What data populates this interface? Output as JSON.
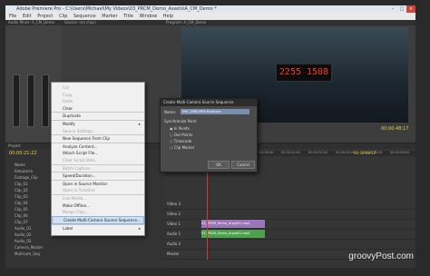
{
  "window": {
    "title": "Adobe Premiere Pro - C:\\Users\\Michael\\My Videos\\03_PRCM_Demo_Assets\\A_CM_Demo *",
    "controls": [
      "–",
      "□",
      "×"
    ]
  },
  "menubar": [
    "File",
    "Edit",
    "Project",
    "Clip",
    "Sequence",
    "Marker",
    "Title",
    "Window",
    "Help"
  ],
  "panels": {
    "audio_mixer_tab": "Audio Mixer: A_CM_Demo",
    "source_tab": "Source: (no clips)",
    "program_tab": "Program: A_CM_Demo",
    "project_tab": "Project",
    "timeline_tab": "Timeline: A_CM_Demo"
  },
  "video": {
    "clapper_text": "2255 1508"
  },
  "timecodes": {
    "program": "00:00:48:17",
    "left": "00:00:21:22",
    "timeline": "00:00:48:17"
  },
  "project_rows": [
    "Name",
    "Simulacra",
    "Footage_Clip",
    "Clip_01",
    "Clip_02",
    "Clip_03",
    "Clip_04",
    "Clip_05",
    "Clip_06",
    "Clip_07",
    "Audio_01",
    "Audio_02",
    "Audio_03",
    "Camera_Master",
    "Multicam_Seq"
  ],
  "timeline": {
    "ruler": [
      "00:00",
      "00:00:08:00",
      "00:00:16:00",
      "00:00:24:00",
      "00:00:32:00",
      "00:00:40:00",
      "00:00:48:00",
      "00:00:56:00"
    ],
    "tracks": [
      "Video 3",
      "Video 2",
      "Video 1",
      "Audio 1",
      "Audio 2",
      "Master"
    ],
    "clip_video_label": "03_PRCM_Demo_Angle01.mp4",
    "clip_audio_label": "03_PRCM_Demo_Angle01.mp4"
  },
  "context_menu": {
    "items": [
      {
        "label": "Cut",
        "enabled": false,
        "sep": false,
        "sub": false
      },
      {
        "label": "Copy",
        "enabled": false,
        "sep": false,
        "sub": false
      },
      {
        "label": "Paste",
        "enabled": false,
        "sep": false,
        "sub": false
      },
      {
        "label": "Clear",
        "enabled": true,
        "sep": false,
        "sub": false
      },
      {
        "label": "Duplicate",
        "enabled": true,
        "sep": true,
        "sub": false
      },
      {
        "label": "Modify",
        "enabled": true,
        "sep": true,
        "sub": true
      },
      {
        "label": "Source Settings...",
        "enabled": false,
        "sep": false,
        "sub": false
      },
      {
        "label": "New Sequence From Clip",
        "enabled": true,
        "sep": true,
        "sub": false
      },
      {
        "label": "Analyze Content...",
        "enabled": true,
        "sep": true,
        "sub": false
      },
      {
        "label": "Attach Script File...",
        "enabled": true,
        "sep": false,
        "sub": false
      },
      {
        "label": "Clear Script Data",
        "enabled": false,
        "sep": false,
        "sub": false
      },
      {
        "label": "Batch Capture...",
        "enabled": false,
        "sep": true,
        "sub": false
      },
      {
        "label": "Speed/Duration...",
        "enabled": true,
        "sep": true,
        "sub": false
      },
      {
        "label": "Open in Source Monitor",
        "enabled": true,
        "sep": true,
        "sub": false
      },
      {
        "label": "Open in Timeline",
        "enabled": false,
        "sep": false,
        "sub": false
      },
      {
        "label": "Link Media...",
        "enabled": false,
        "sep": true,
        "sub": false
      },
      {
        "label": "Make Offline...",
        "enabled": true,
        "sep": false,
        "sub": false
      },
      {
        "label": "Merge Clips...",
        "enabled": false,
        "sep": false,
        "sub": false
      },
      {
        "label": "Create Multi-Camera Source Sequence...",
        "enabled": true,
        "sep": false,
        "sub": false,
        "highlight": true
      },
      {
        "label": "Label",
        "enabled": true,
        "sep": true,
        "sub": true
      }
    ]
  },
  "dialog": {
    "title": "Create Multi-Camera Source Sequence",
    "name_label": "Name:",
    "name_value": "MVI_1960.MP4 Multicam",
    "sync_label": "Synchronize Point",
    "options": [
      "In Points",
      "Out Points",
      "Timecode",
      "Clip Marker"
    ],
    "selected": "In Points",
    "ok": "OK",
    "cancel": "Cancel"
  },
  "watermark": "groovyPost.com"
}
